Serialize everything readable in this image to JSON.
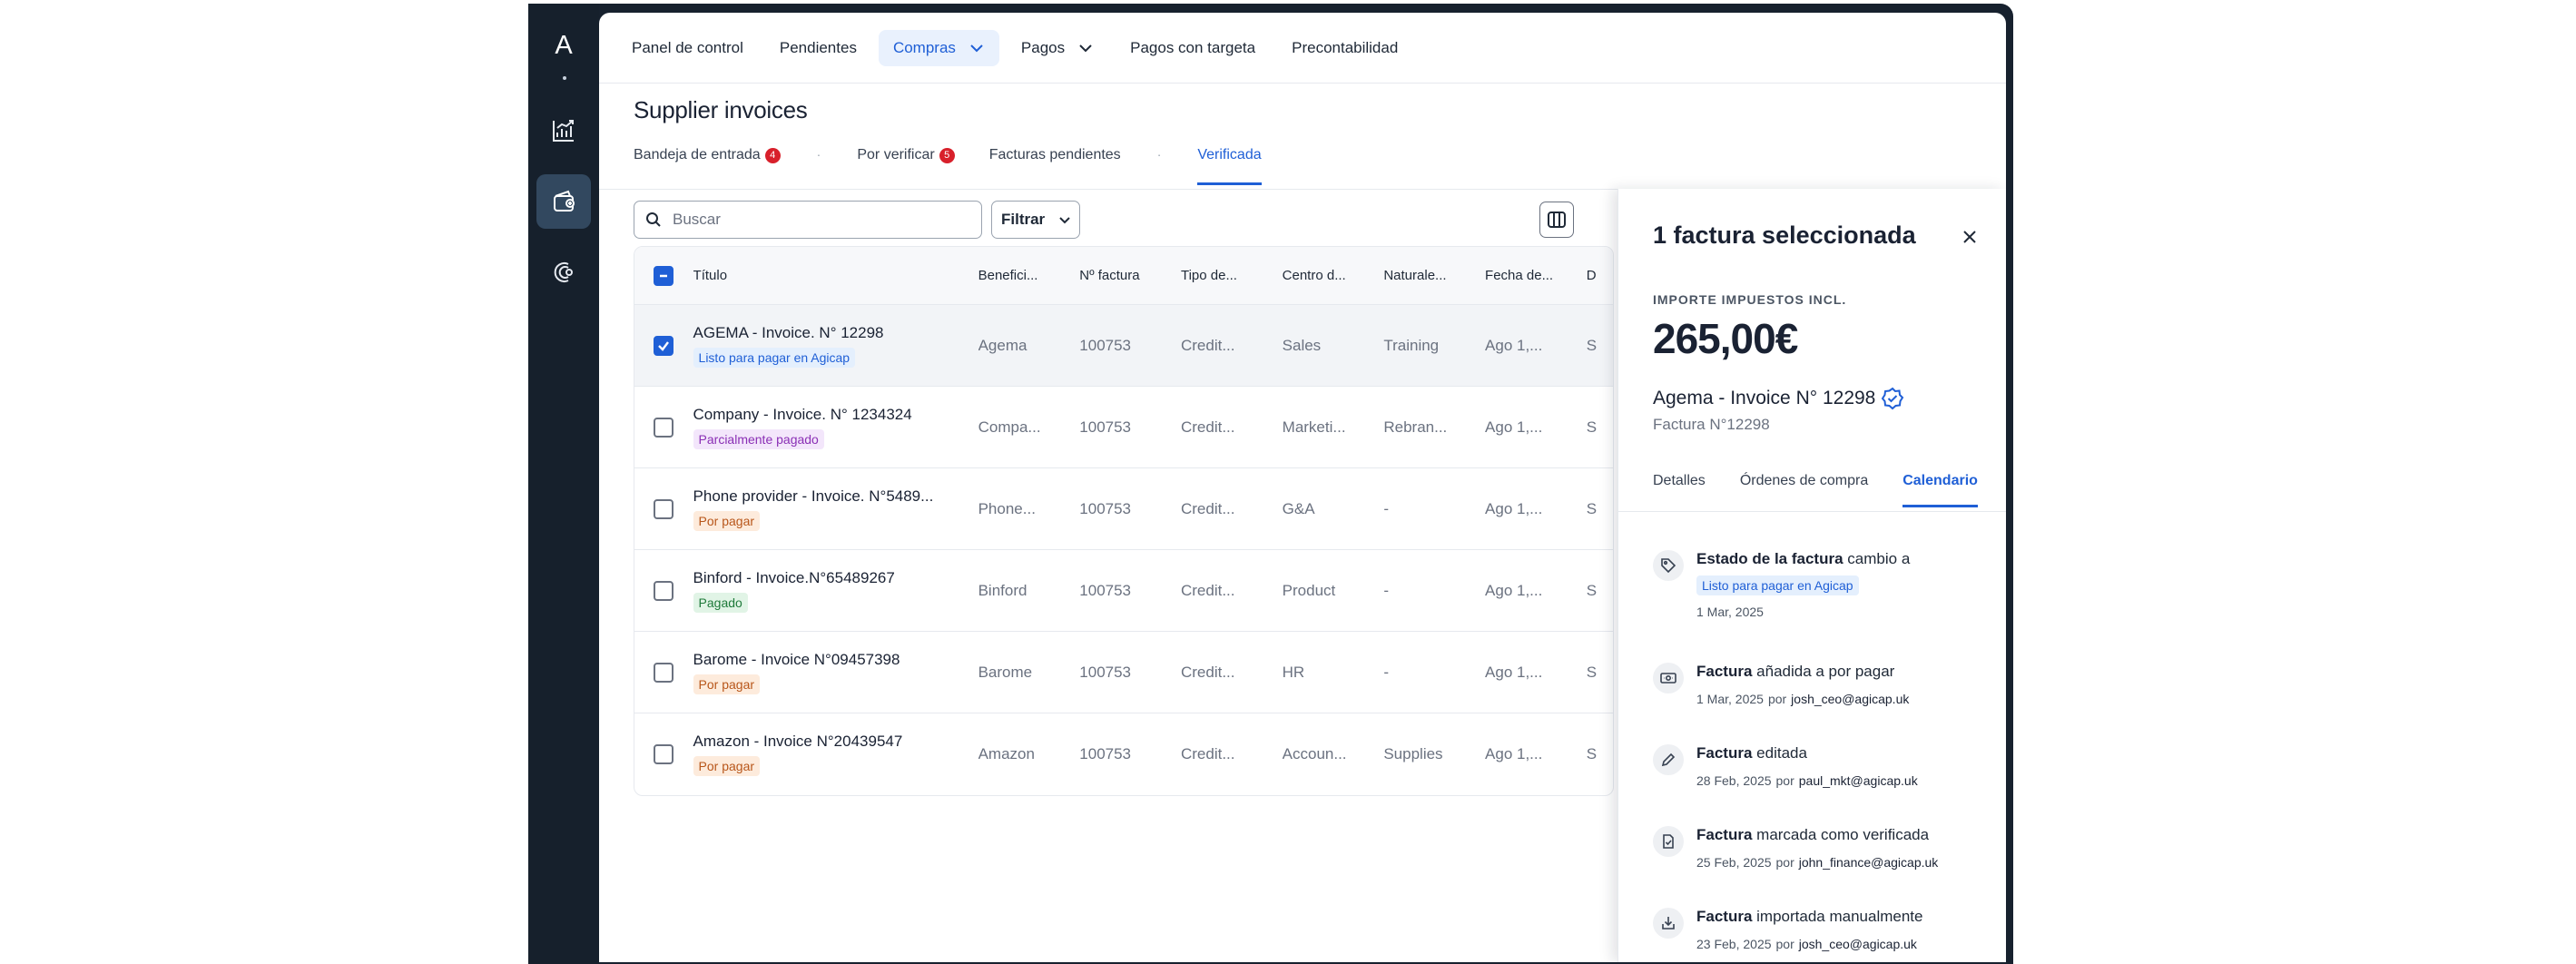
{
  "rail": {
    "logo": "A",
    "icons": [
      "chart-icon",
      "wallet-icon",
      "coin-icon"
    ]
  },
  "topnav": {
    "items": [
      {
        "label": "Panel de control"
      },
      {
        "label": "Pendientes"
      },
      {
        "label": "Compras",
        "active": true,
        "dropdown": true
      },
      {
        "label": "Pagos",
        "dropdown": true
      },
      {
        "label": "Pagos con targeta"
      },
      {
        "label": "Precontabilidad"
      }
    ]
  },
  "page": {
    "title": "Supplier invoices",
    "tabs": [
      {
        "label": "Bandeja de entrada",
        "badge": "4"
      },
      {
        "label": "Por verificar",
        "badge": "5"
      },
      {
        "label": "Facturas pendientes"
      },
      {
        "label": "Verificada",
        "active": true
      }
    ]
  },
  "toolbar": {
    "search_placeholder": "Buscar",
    "filter_label": "Filtrar"
  },
  "table": {
    "columns": [
      "Título",
      "Benefici...",
      "Nº factura",
      "Tipo de...",
      "Centro d...",
      "Naturale...",
      "Fecha de...",
      "D"
    ],
    "rows": [
      {
        "title": "AGEMA - Invoice. N° 12298",
        "status": "Listo para pagar en Agicap",
        "status_color": "blue",
        "beneficiary": "Agema",
        "number": "100753",
        "type": "Credit...",
        "center": "Sales",
        "nature": "Training",
        "date": "Ago 1,...",
        "extra": "S",
        "selected": true
      },
      {
        "title": "Company - Invoice. N° 1234324",
        "status": "Parcialmente pagado",
        "status_color": "purple",
        "beneficiary": "Compa...",
        "number": "100753",
        "type": "Credit...",
        "center": "Marketi...",
        "nature": "Rebran...",
        "date": "Ago 1,...",
        "extra": "S",
        "selected": false
      },
      {
        "title": "Phone provider - Invoice. N°5489...",
        "status": "Por pagar",
        "status_color": "orange",
        "beneficiary": "Phone...",
        "number": "100753",
        "type": "Credit...",
        "center": "G&A",
        "nature": "-",
        "date": "Ago 1,...",
        "extra": "S",
        "selected": false
      },
      {
        "title": "Binford - Invoice.N°65489267",
        "status": "Pagado",
        "status_color": "green",
        "beneficiary": "Binford",
        "number": "100753",
        "type": "Credit...",
        "center": "Product",
        "nature": "-",
        "date": "Ago 1,...",
        "extra": "S",
        "selected": false
      },
      {
        "title": "Barome - Invoice N°09457398",
        "status": "Por pagar",
        "status_color": "orange",
        "beneficiary": "Barome",
        "number": "100753",
        "type": "Credit...",
        "center": "HR",
        "nature": "-",
        "date": "Ago 1,...",
        "extra": "S",
        "selected": false
      },
      {
        "title": "Amazon - Invoice N°20439547",
        "status": "Por pagar",
        "status_color": "orange",
        "beneficiary": "Amazon",
        "number": "100753",
        "type": "Credit...",
        "center": "Accoun...",
        "nature": "Supplies",
        "date": "Ago 1,...",
        "extra": "S",
        "selected": false
      }
    ]
  },
  "panel": {
    "title": "1 factura seleccionada",
    "amount_label": "IMPORTE IMPUESTOS INCL.",
    "amount": "265,00€",
    "invoice_name": "Agema - Invoice N° 12298",
    "invoice_sub": "Factura N°12298",
    "tabs": [
      {
        "label": "Detalles"
      },
      {
        "label": "Órdenes de compra"
      },
      {
        "label": "Calendario",
        "active": true
      }
    ],
    "timeline": [
      {
        "icon": "tag-icon",
        "subject": "Estado de la factura",
        "action": "cambio a",
        "badge": "Listo para pagar en Agicap",
        "date": "1 Mar, 2025"
      },
      {
        "icon": "cash-icon",
        "subject": "Factura",
        "action": "añadida a por pagar",
        "date": "1 Mar, 2025",
        "by": "por",
        "who": "josh_ceo@agicap.uk"
      },
      {
        "icon": "pencil-icon",
        "subject": "Factura",
        "action": "editada",
        "date": "28 Feb, 2025",
        "by": "por",
        "who": "paul_mkt@agicap.uk"
      },
      {
        "icon": "file-check-icon",
        "subject": "Factura",
        "action": "marcada como verificada",
        "date": "25 Feb, 2025",
        "by": "por",
        "who": "john_finance@agicap.uk"
      },
      {
        "icon": "import-icon",
        "subject": "Factura",
        "action": "importada manualmente",
        "date": "23 Feb, 2025",
        "by": "por",
        "who": "josh_ceo@agicap.uk"
      }
    ]
  },
  "colors": {
    "accent": "#1f5fd6",
    "rail": "#16202c",
    "badge_red": "#d8202b"
  }
}
